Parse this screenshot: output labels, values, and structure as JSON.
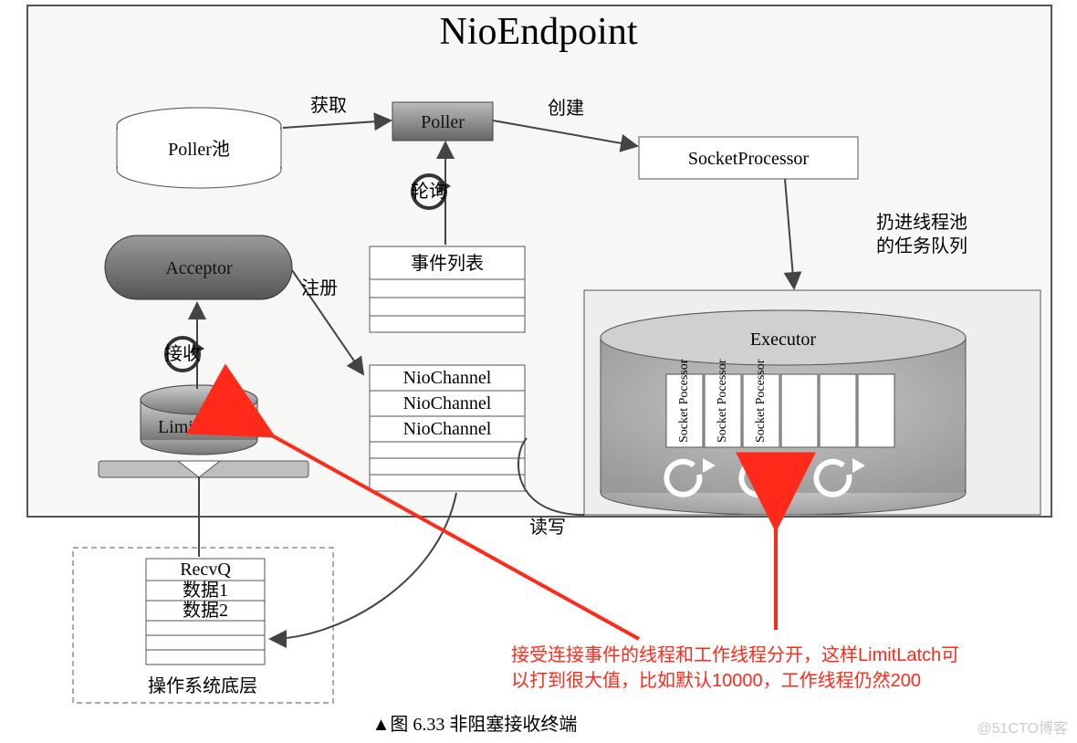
{
  "title": "NioEndpoint",
  "nodes": {
    "poller_pool": "Poller池",
    "poller": "Poller",
    "socket_processor": "SocketProcessor",
    "acceptor": "Acceptor",
    "limit_latch": "LimitLatch",
    "event_list": "事件列表",
    "nio_channel_1": "NioChannel",
    "nio_channel_2": "NioChannel",
    "nio_channel_3": "NioChannel",
    "executor": "Executor",
    "recvq": "RecvQ",
    "recvq_row1": "数据1",
    "recvq_row2": "数据2",
    "os_layer": "操作系统底层",
    "exec_slot": "Socket\nPocessor"
  },
  "edges": {
    "fetch": "获取",
    "create": "创建",
    "poll": "轮询",
    "register": "注册",
    "accept": "接收",
    "throw_to_pool_l1": "扔进线程池",
    "throw_to_pool_l2": "的任务队列",
    "read_write": "读写"
  },
  "caption": "▲图 6.33  非阻塞接收终端",
  "annotation": {
    "line1": "接受连接事件的线程和工作线程分开，这样LimitLatch可",
    "line2": "以打到很大值，比如默认10000，工作线程仍然200"
  },
  "watermark": "@51CTO博客"
}
